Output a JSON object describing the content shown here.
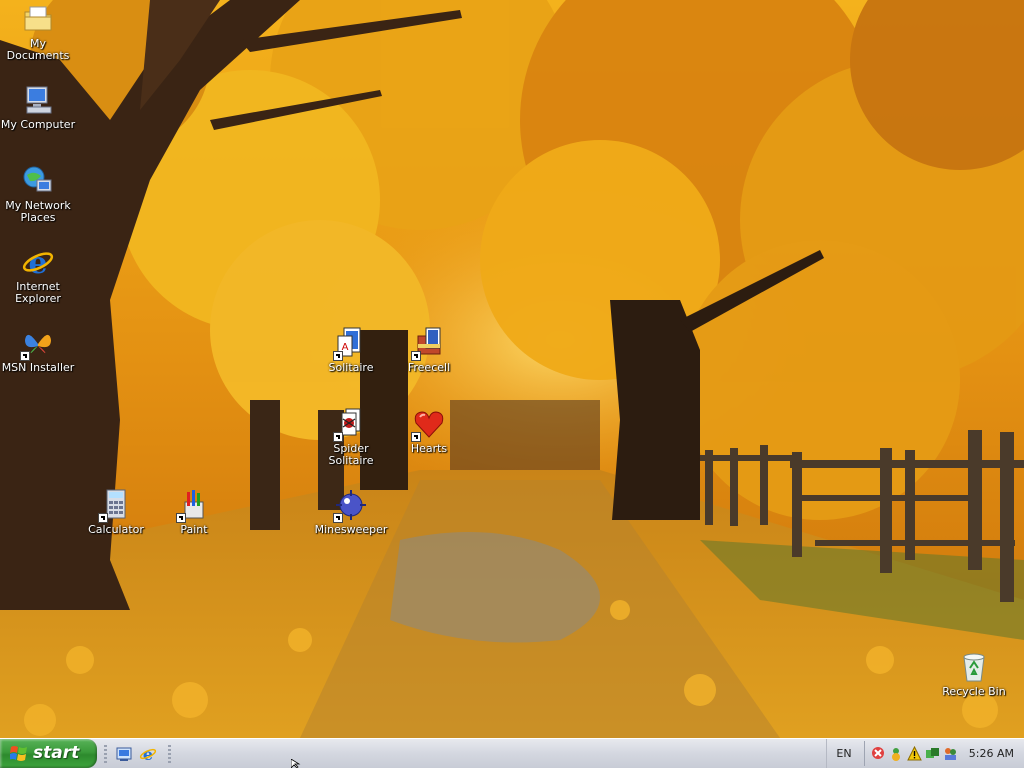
{
  "desktop": {
    "icons": [
      {
        "label": "My Documents",
        "icon": "my-documents-icon"
      },
      {
        "label": "My Computer",
        "icon": "my-computer-icon"
      },
      {
        "label": "My Network Places",
        "icon": "network-places-icon"
      },
      {
        "label": "Internet Explorer",
        "icon": "internet-explorer-icon"
      },
      {
        "label": "MSN Installer",
        "icon": "msn-butterfly-icon"
      },
      {
        "label": "Solitaire",
        "icon": "solitaire-icon"
      },
      {
        "label": "Freecell",
        "icon": "freecell-icon"
      },
      {
        "label": "Spider Solitaire",
        "icon": "spider-solitaire-icon"
      },
      {
        "label": "Hearts",
        "icon": "hearts-icon"
      },
      {
        "label": "Calculator",
        "icon": "calculator-icon"
      },
      {
        "label": "Paint",
        "icon": "paint-icon"
      },
      {
        "label": "Minesweeper",
        "icon": "minesweeper-icon"
      },
      {
        "label": "Recycle Bin",
        "icon": "recycle-bin-icon"
      }
    ]
  },
  "taskbar": {
    "start_label": "start",
    "quick_launch": [
      {
        "icon": "show-desktop-icon"
      },
      {
        "icon": "internet-explorer-icon"
      }
    ],
    "language": "EN",
    "tray_icons": [
      "network-icon",
      "messenger-icon",
      "security-alert-icon",
      "sync-icon",
      "users-icon"
    ],
    "clock": "5:26 AM"
  },
  "colors": {
    "start_green": "#3a9a3a",
    "taskbar_silver": "#d4d7e0",
    "foliage_orange": "#e39a12"
  }
}
